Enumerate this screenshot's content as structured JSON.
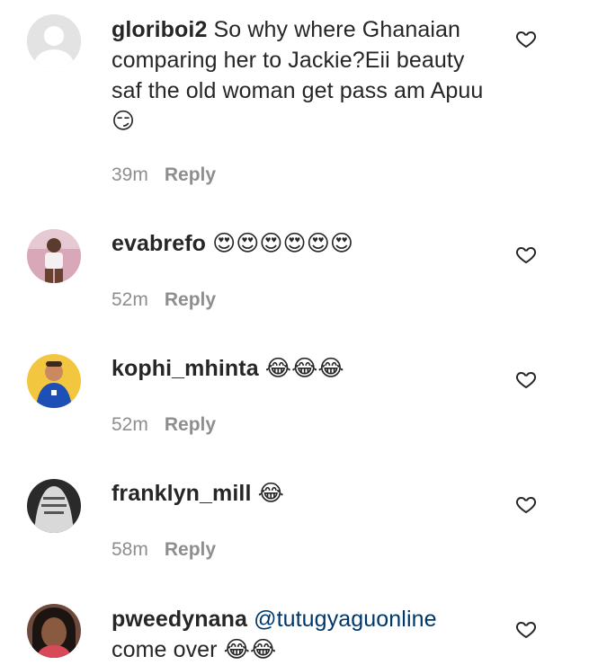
{
  "comments": [
    {
      "username": "gloriboi2",
      "text": "So why where Ghanaian comparing her to Jackie?Eii beauty saf the old woman get pass am Apuu",
      "emoji": "😏",
      "mention": "",
      "time": "39m",
      "reply_label": "Reply",
      "avatar": "default-avatar-icon"
    },
    {
      "username": "evabrefo",
      "text": "",
      "emoji": "😍😍😍😍😍😍",
      "mention": "",
      "time": "52m",
      "reply_label": "Reply",
      "avatar": "user-photo"
    },
    {
      "username": "kophi_mhinta",
      "text": "",
      "emoji": "😂😂😂",
      "mention": "",
      "time": "52m",
      "reply_label": "Reply",
      "avatar": "user-photo"
    },
    {
      "username": "franklyn_mill",
      "text": "",
      "emoji": "😂",
      "mention": "",
      "time": "58m",
      "reply_label": "Reply",
      "avatar": "user-photo"
    },
    {
      "username": "pweedynana",
      "text": "come over",
      "emoji": "😂😂",
      "mention": "@tutugyaguonline",
      "time": "",
      "reply_label": "",
      "avatar": "user-photo"
    }
  ],
  "colors": {
    "text": "#262626",
    "meta": "#8e8e8e",
    "mention": "#00376b",
    "background": "#ffffff"
  }
}
